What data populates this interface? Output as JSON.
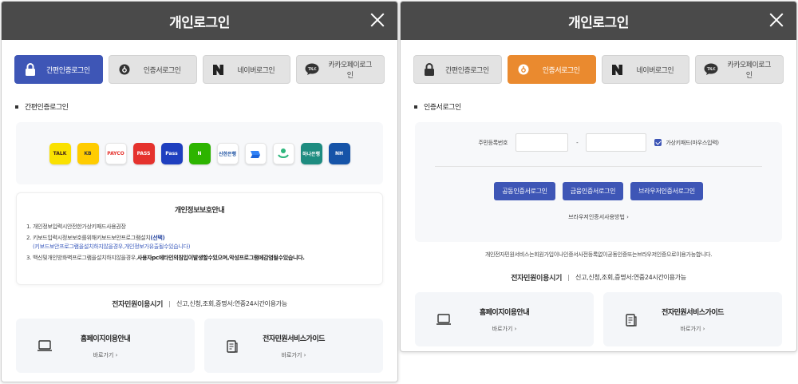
{
  "left": {
    "title": "개인로그인",
    "tabs": [
      {
        "label": "간편인증로그인",
        "icon": "lock-icon"
      },
      {
        "label": "인증서로그인",
        "icon": "certificate-icon"
      },
      {
        "label": "네이버로그인",
        "icon": "naver-icon"
      },
      {
        "label": "카카오페이로그인",
        "icon": "kakaotalk-icon"
      }
    ],
    "section_title": "간편인증로그인",
    "apps": [
      {
        "name": "kakaotalk",
        "label": "TALK",
        "bg": "#fae100",
        "fg": "#3c1e1e"
      },
      {
        "name": "kb",
        "label": "KB",
        "bg": "#ffcc00",
        "fg": "#3b3b3b"
      },
      {
        "name": "payco",
        "label": "PAYCO",
        "bg": "#ffffff",
        "fg": "#e5322d"
      },
      {
        "name": "pass-red",
        "label": "PASS",
        "bg": "#e5322d",
        "fg": "#ffffff"
      },
      {
        "name": "pass-blue",
        "label": "Pass",
        "bg": "#1e3fbf",
        "fg": "#ffffff"
      },
      {
        "name": "naver",
        "label": "N",
        "bg": "#2db400",
        "fg": "#ffffff"
      },
      {
        "name": "shinhan",
        "label": "신한은행",
        "bg": "#ffffff",
        "fg": "#1a4fa0"
      },
      {
        "name": "toss",
        "label": "toss",
        "bg": "#ffffff",
        "fg": "#3182f6"
      },
      {
        "name": "samsungpass",
        "label": "",
        "bg": "#ffffff",
        "fg": "#2eb67d"
      },
      {
        "name": "hana",
        "label": "하나은행",
        "bg": "#1e8c80",
        "fg": "#ffffff"
      },
      {
        "name": "nh",
        "label": "NH",
        "bg": "#1654a8",
        "fg": "#ffffff"
      }
    ],
    "privacy": {
      "title": "개인정보보호안내",
      "item1": "1. 개인정보입력시안전한가상키패드사용권장",
      "item2_pre": "2. 키보드입력시정보보호를위해키보드보안프로그램설치",
      "item2_link": "(선택)",
      "item2_sub": "(키보드보안프로그램을설치하지않을경우,개인정보가유출될수있습니다)",
      "item3_pre": "3. 백신및개인방화벽프로그램을설치하지않을경우,",
      "item3_bold": "사용자pc에타인의침입이발생할수있으며,악성프로그램에감염될수있습니다."
    },
    "service": {
      "title": "전자민원이용시기",
      "desc": "신고,신청,조회,증명서:연중24시간이용가능"
    },
    "cards": [
      {
        "name": "홈페이지이용안내",
        "go": "바로가기 ›"
      },
      {
        "name": "전자민원서비스가이드",
        "go": "바로가기 ›"
      }
    ]
  },
  "right": {
    "title": "개인로그인",
    "tabs": [
      {
        "label": "간편인증로그인",
        "icon": "lock-icon"
      },
      {
        "label": "인증서로그인",
        "icon": "certificate-icon"
      },
      {
        "label": "네이버로그인",
        "icon": "naver-icon"
      },
      {
        "label": "카카오페이로그인",
        "icon": "kakaotalk-icon"
      }
    ],
    "section_title": "인증서로그인",
    "form": {
      "rrn_label": "주민등록번호",
      "dash": "-",
      "keypad_label": "가상키패드(마우스입력)",
      "keypad_checked": true
    },
    "buttons": [
      "공동인증서로그인",
      "금융인증서로그인",
      "브라우저인증서로그인"
    ],
    "browser_link": "브라우저인증서사용방법 ›",
    "notice": "개인전자민원서비스는회원가입이나인증서사전등록없이공동인증또는브라우저인증으로이용가능합니다.",
    "service": {
      "title": "전자민원이용시기",
      "desc": "신고,신청,조회,증명서:연중24시간이용가능"
    },
    "cards": [
      {
        "name": "홈페이지이용안내",
        "go": "바로가기 ›"
      },
      {
        "name": "전자민원서비스가이드",
        "go": "바로가기 ›"
      }
    ]
  },
  "colors": {
    "header": "#4a4a4a",
    "active_blue": "#3e56b6",
    "active_orange": "#ea8a2f"
  }
}
